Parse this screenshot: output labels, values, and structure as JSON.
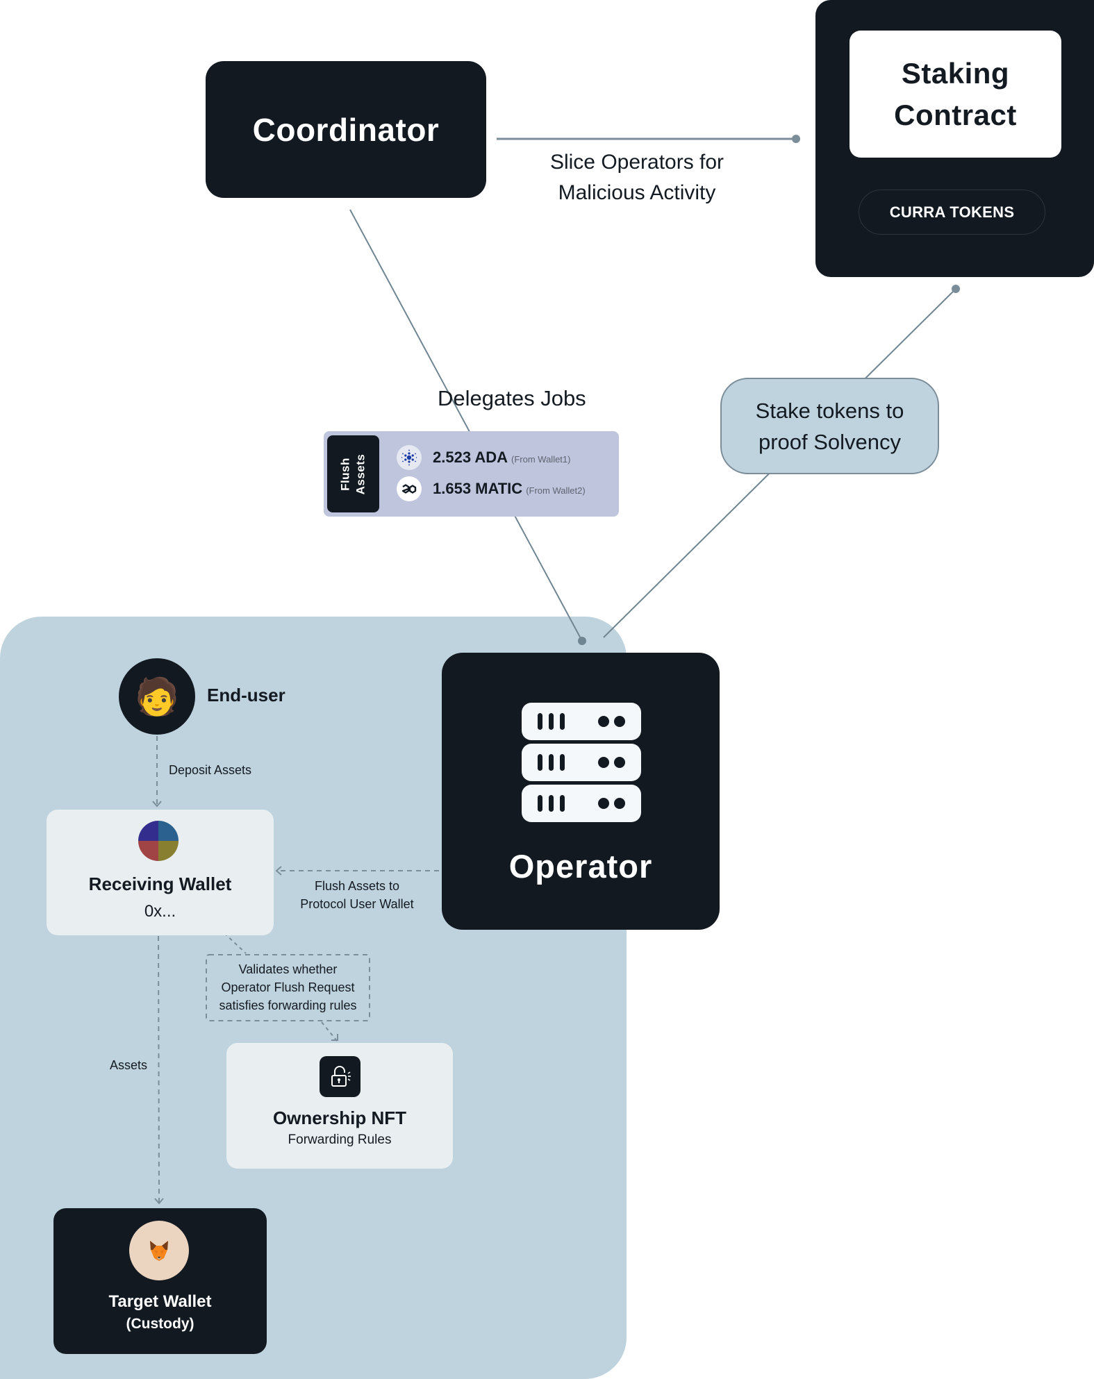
{
  "coordinator": {
    "title": "Coordinator"
  },
  "staking_contract": {
    "title_line1": "Staking",
    "title_line2": "Contract",
    "token_badge": "CURRA TOKENS"
  },
  "edges": {
    "slice": {
      "line1": "Slice Operators for",
      "line2": "Malicious Activity"
    },
    "delegates": {
      "label": "Delegates Jobs"
    },
    "stake": {
      "line1": "Stake tokens to",
      "line2": "proof Solvency"
    },
    "deposit": {
      "label": "Deposit Assets"
    },
    "flush_to_wallet": {
      "line1": "Flush Assets to",
      "line2": "Protocol User Wallet"
    },
    "validates": {
      "line1": "Validates whether",
      "line2": "Operator Flush Request",
      "line3": "satisfies forwarding rules"
    },
    "assets": {
      "label": "Assets"
    }
  },
  "flush_assets": {
    "tab_line1": "Flush",
    "tab_line2": "Assets",
    "items": [
      {
        "icon": "cardano-icon",
        "amount": "2.523 ADA",
        "source": "(From Wallet1)"
      },
      {
        "icon": "polygon-icon",
        "amount": "1.653 MATIC",
        "source": "(From Wallet2)"
      }
    ]
  },
  "operator": {
    "title": "Operator",
    "icon": "server-rack-icon"
  },
  "end_user": {
    "label": "End-user",
    "icon": "person-red-hair-emoji",
    "emoji": "🧑"
  },
  "receiving_wallet": {
    "title": "Receiving Wallet",
    "address": "0x..."
  },
  "ownership_nft": {
    "title": "Ownership NFT",
    "subtitle": "Forwarding Rules",
    "icon": "unlock-icon"
  },
  "target_wallet": {
    "title": "Target Wallet",
    "subtitle": "(Custody)",
    "icon": "metamask-fox-icon"
  },
  "colors": {
    "dark": "#121920",
    "region": "#bfd3de",
    "flush_card": "#bec5dd",
    "light_card": "#e9eef1",
    "connector": "#6f8592"
  }
}
